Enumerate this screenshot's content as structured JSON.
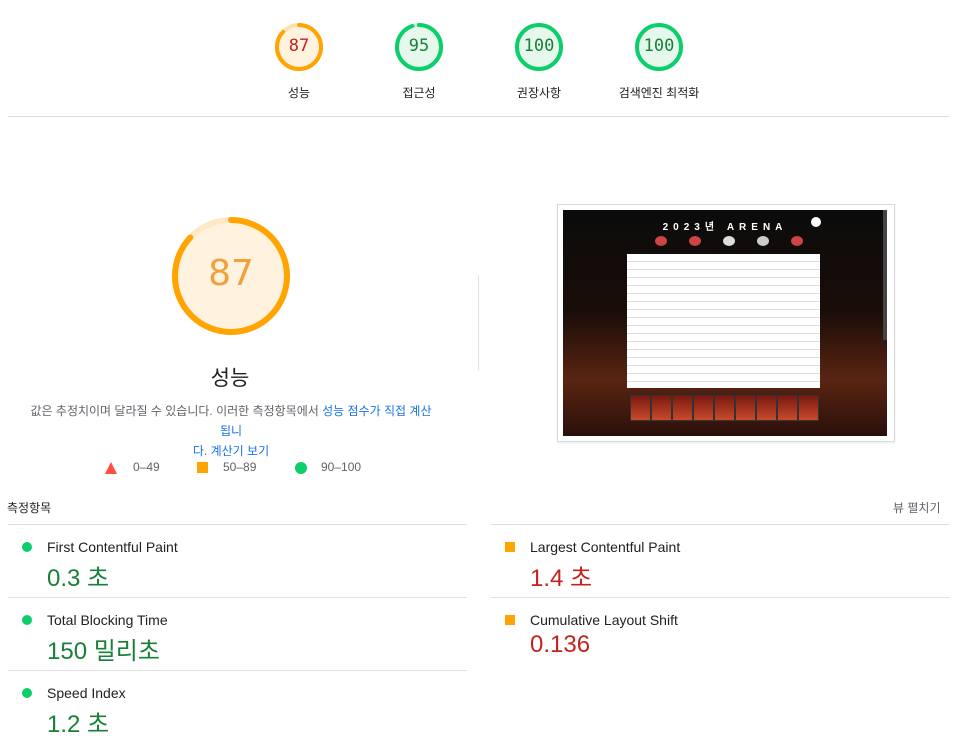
{
  "gauges": [
    {
      "score": "87",
      "label": "성능",
      "status": "average"
    },
    {
      "score": "95",
      "label": "접근성",
      "status": "pass"
    },
    {
      "score": "100",
      "label": "권장사항",
      "status": "pass"
    },
    {
      "score": "100",
      "label": "검색엔진 최적화",
      "status": "pass"
    }
  ],
  "main": {
    "score": "87",
    "score_fraction": 0.87,
    "title": "성능",
    "desc_prefix": "값은 추정치이며 달라질 수 있습니다. 이러한 측정항목에서 ",
    "desc_link1": "성능 점수가 직접 계산됩니",
    "desc_link1b": "다",
    "desc_mid": ". ",
    "desc_link2": "계산기 보기"
  },
  "legend": [
    {
      "range": "0–49",
      "shape": "triangle-icon"
    },
    {
      "range": "50–89",
      "shape": "square-icon"
    },
    {
      "range": "90–100",
      "shape": "circle-icon"
    }
  ],
  "screenshot": {
    "title": "2023년 ARENA"
  },
  "metrics": {
    "header": "측정항목",
    "expand_label": "뷰 펼치기",
    "items": [
      {
        "name": "First Contentful Paint",
        "value": "0.3 초",
        "status": "pass"
      },
      {
        "name": "Largest Contentful Paint",
        "value": "1.4 초",
        "status": "average"
      },
      {
        "name": "Total Blocking Time",
        "value": "150 밀리초",
        "status": "pass"
      },
      {
        "name": "Cumulative Layout Shift",
        "value": "0.136",
        "status": "average"
      },
      {
        "name": "Speed Index",
        "value": "1.2 초",
        "status": "pass"
      }
    ]
  },
  "colors": {
    "pass": "#0cce6b",
    "average": "#ffa400",
    "fail": "#ff4e42",
    "pass_text": "#188038",
    "average_text": "#c5221f"
  }
}
